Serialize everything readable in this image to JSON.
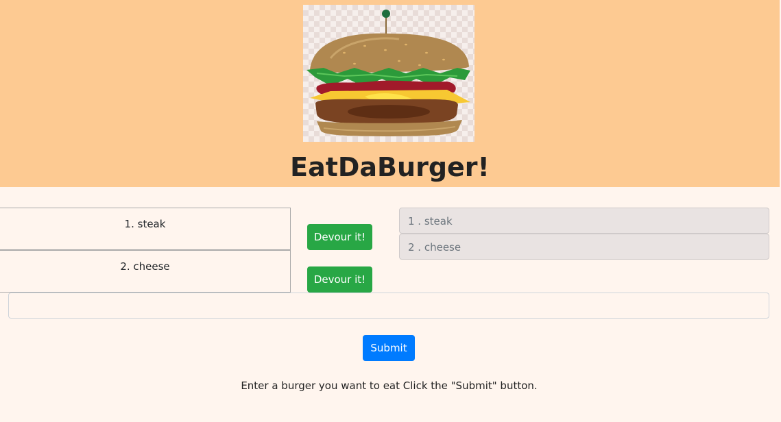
{
  "header": {
    "title": "EatDaBurger!",
    "background_color": "#fdca92",
    "logo_icon": "hamburger-icon"
  },
  "burgers": [
    {
      "label": "1. steak",
      "devour_label": "Devour it!"
    },
    {
      "label": "2. cheese",
      "devour_label": "Devour it!"
    }
  ],
  "devoured": [
    {
      "label": "1 . steak"
    },
    {
      "label": "2 . cheese"
    }
  ],
  "form": {
    "input_value": "",
    "input_placeholder": "",
    "submit_label": "Submit",
    "instructions": "Enter a burger you want to eat Click the \"Submit\" button."
  },
  "colors": {
    "page_background": "#fff5ee",
    "devour_button": "#28a745",
    "submit_button": "#007bff"
  }
}
